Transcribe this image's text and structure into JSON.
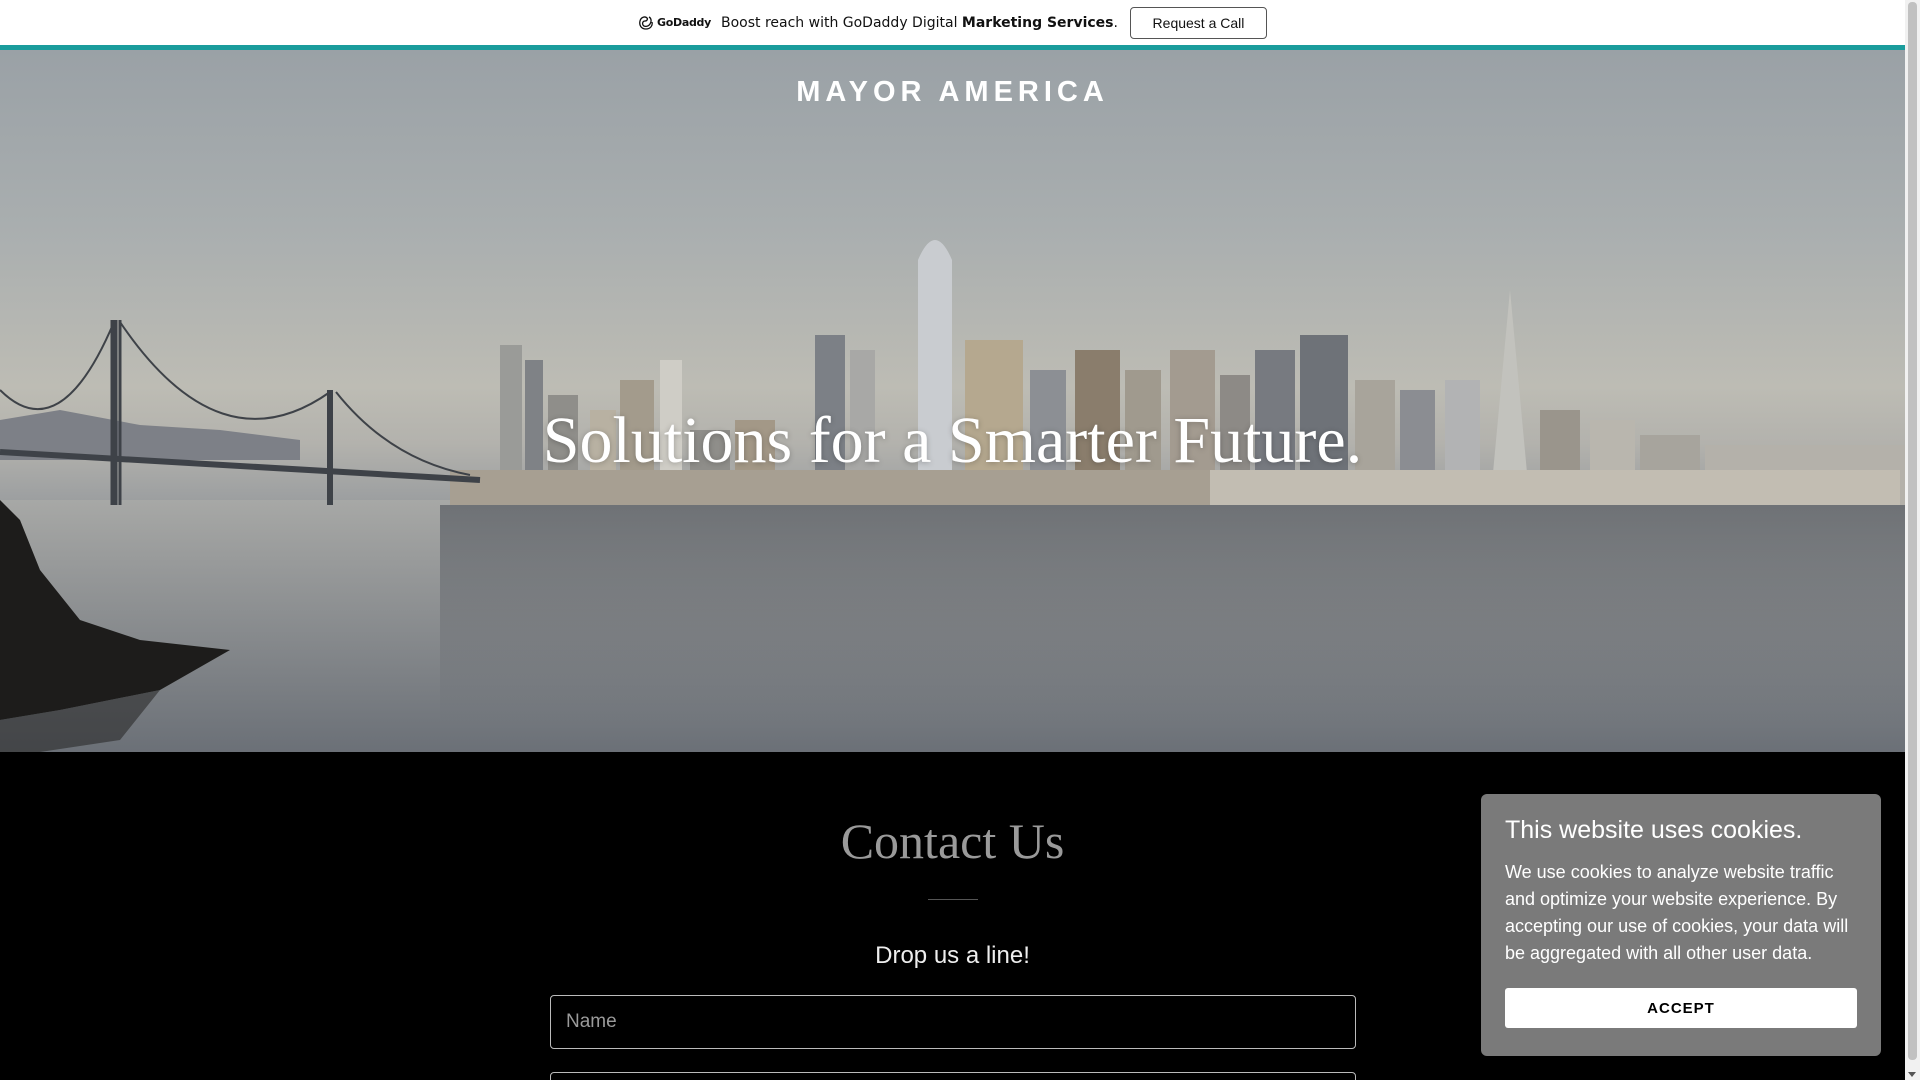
{
  "promo": {
    "logo_text": "GoDaddy",
    "text": "Boost reach with GoDaddy Digital ",
    "text_bold": "Marketing Services",
    "text_end": ".",
    "button_label": "Request a Call",
    "accent_color": "#1a9c9c"
  },
  "hero": {
    "brand": "MAYOR AMERICA",
    "title": "Solutions for a Smarter Future."
  },
  "contact": {
    "title": "Contact Us",
    "subtitle": "Drop us a line!",
    "name_placeholder": "Name"
  },
  "cookie": {
    "title": "This website uses cookies.",
    "body": "We use cookies to analyze website traffic and optimize your website experience. By accepting our use of cookies, your data will be aggregated with all other user data.",
    "accept_label": "ACCEPT"
  }
}
